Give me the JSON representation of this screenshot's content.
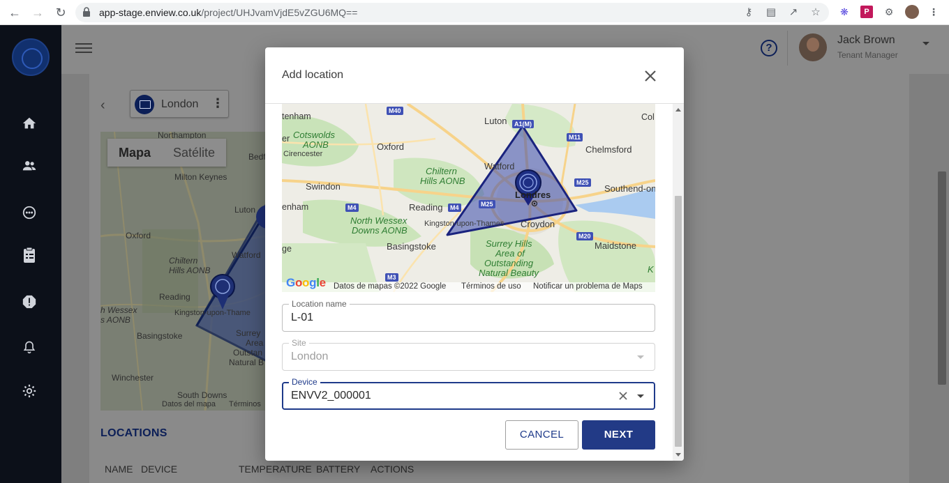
{
  "browser": {
    "url_host": "app-stage.enview.co.uk",
    "url_path": "/project/UHJvamVjdE5vZGU6MQ=="
  },
  "sidebar": {
    "items": [
      {
        "icon": "home-icon"
      },
      {
        "icon": "users-icon"
      },
      {
        "icon": "target-icon"
      },
      {
        "icon": "clipboard-icon"
      },
      {
        "icon": "alert-icon"
      },
      {
        "icon": "bell-icon"
      },
      {
        "icon": "settings-icon"
      }
    ]
  },
  "header": {
    "help": "?",
    "user_name": "Jack Brown",
    "user_role": "Tenant Manager"
  },
  "project": {
    "name": "London"
  },
  "bg_map": {
    "tabs": [
      "Mapa",
      "Satélite"
    ],
    "labels": [
      "Northampton",
      "Bedford",
      "Milton Keynes",
      "Luton",
      "Oxford",
      "Chiltern",
      "Hills AONB",
      "Watford",
      "Reading",
      "h Wessex",
      "s AONB",
      "Kingston-upon-Thame",
      "Basingstoke",
      "Surrey",
      "Area",
      "Outstan",
      "Natural B",
      "Winchester",
      "South Downs"
    ],
    "footer": [
      "Datos del mapa",
      "Términos"
    ]
  },
  "locations": {
    "title": "LOCATIONS",
    "columns": [
      "NAME",
      "DEVICE",
      "TEMPERATURE",
      "BATTERY",
      "ACTIONS"
    ]
  },
  "modal": {
    "title": "Add location",
    "map": {
      "labels": {
        "tenham": "tenham",
        "luton": "Luton",
        "col": "Col",
        "cotswolds": "Cotswolds",
        "aonb1": "AONB",
        "er": "er",
        "cirencester": "Cirencester",
        "oxford": "Oxford",
        "chelmsford": "Chelmsford",
        "chiltern": "Chiltern",
        "hills": "Hills AONB",
        "watford": "Watford",
        "swindon": "Swindon",
        "londres": "Londres",
        "southend": "Southend-on",
        "enham": "enham",
        "reading": "Reading",
        "north_wessex": "North Wessex",
        "downs": "Downs AONB",
        "kingston": "Kingston-upon-Thames",
        "croydon": "Croydon",
        "basingstoke": "Basingstoke",
        "surrey": "Surrey Hills",
        "area_of": "Area of",
        "outstanding": "Outstanding",
        "natural_beauty": "Natural Beauty",
        "maidstone": "Maidstone",
        "ge": "ge",
        "k": "K"
      },
      "shields": {
        "m40": "M40",
        "a1m": "A1(M)",
        "m11": "M11",
        "m25a": "M25",
        "m4a": "M4",
        "m4b": "M4",
        "m25b": "M25",
        "m20": "M20",
        "m3": "M3"
      },
      "google": "Google",
      "footer": {
        "data": "Datos de mapas ©2022 Google",
        "terms": "Términos de uso",
        "report": "Notificar un problema de Maps"
      }
    },
    "fields": {
      "location_name": {
        "label": "Location name",
        "value": "L-01"
      },
      "site": {
        "label": "Site",
        "value": "London"
      },
      "device": {
        "label": "Device",
        "value": "ENVV2_000001"
      }
    },
    "buttons": {
      "cancel": "CANCEL",
      "next": "NEXT"
    }
  },
  "colors": {
    "primary": "#223a86",
    "polygon_fill": "#5c6bc0",
    "polygon_stroke": "#1a237e",
    "sidebar_bg": "#0c1019"
  }
}
